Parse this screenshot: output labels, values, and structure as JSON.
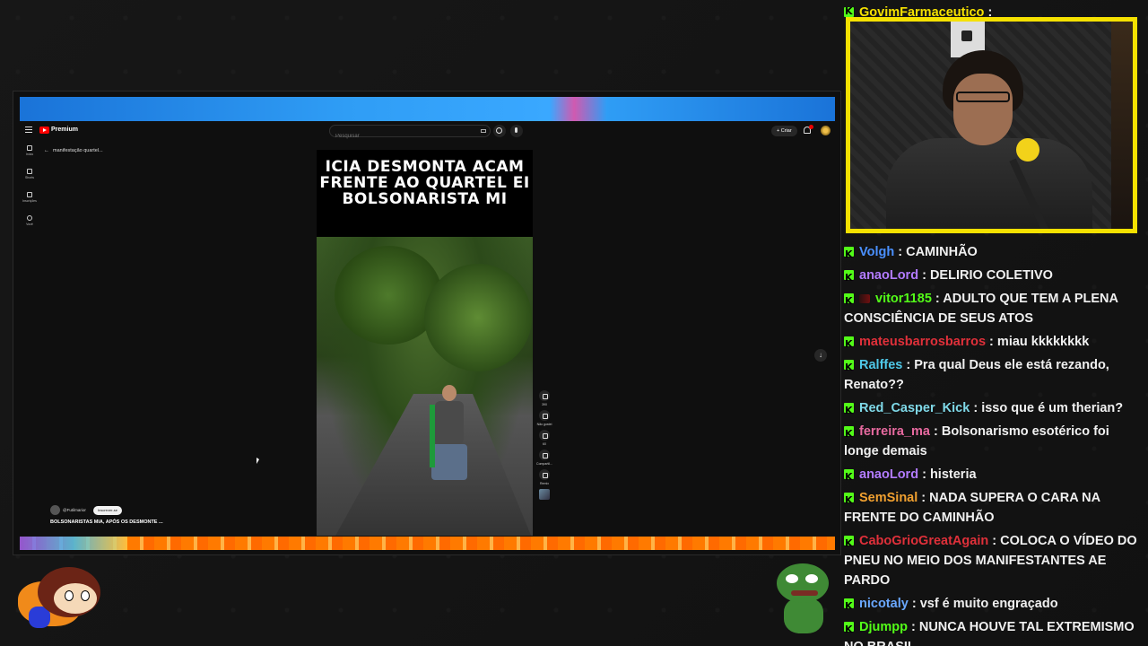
{
  "youtube": {
    "brand": "Premium",
    "search_placeholder": "Pesquisar",
    "create_label": "+ Criar",
    "breadcrumb": "manifestação quartel...",
    "nav": [
      {
        "label": "Início"
      },
      {
        "label": "Shorts"
      },
      {
        "label": "Inscrições"
      },
      {
        "label": "Você"
      }
    ],
    "short": {
      "headline_lines": [
        "ICIA DESMONTA ACAM",
        "FRENTE AO QUARTEL EI",
        "BOLSONARISTA MI"
      ],
      "channel_name": "@Futilmarior",
      "subscribe_label": "Inscrever-se",
      "title": "BOLSONARISTAS MIA, APÓS OS DESMONTE ...",
      "actions": [
        {
          "name": "like",
          "count": "390"
        },
        {
          "name": "dislike",
          "count": "Não gostei"
        },
        {
          "name": "comments",
          "count": "60"
        },
        {
          "name": "share",
          "count": "Compartil..."
        },
        {
          "name": "remix",
          "count": "Remix"
        }
      ]
    }
  },
  "chat": {
    "top_partial": {
      "user": "GovimFarmaceutico",
      "text": ""
    },
    "messages": [
      {
        "user": "Volgh",
        "color": "#4a90ff",
        "text": "CAMINHÃO",
        "badge": "kick"
      },
      {
        "user": "anaoLord",
        "color": "#b27bff",
        "text": "DELIRIO COLETIVO",
        "badge": "kick"
      },
      {
        "user": "vitor1185",
        "color": "#53fc18",
        "text": "ADULTO QUE TEM A PLENA CONSCIÊNCIA DE SEUS ATOS",
        "badge": "kick+mini"
      },
      {
        "user": "mateusbarrosbarros",
        "color": "#e0303a",
        "text": "miau kkkkkkkk",
        "badge": "kick"
      },
      {
        "user": "Ralffes",
        "color": "#4fc8e8",
        "text": "Pra qual Deus ele está rezando, Renato??",
        "badge": "kick"
      },
      {
        "user": "Red_Casper_Kick",
        "color": "#7fd9e8",
        "text": "isso que é um therian?",
        "badge": "kick"
      },
      {
        "user": "ferreira_ma",
        "color": "#e86aa0",
        "text": "Bolsonarismo esotérico foi longe demais",
        "badge": "kick"
      },
      {
        "user": "anaoLord",
        "color": "#b27bff",
        "text": "histeria",
        "badge": "kick"
      },
      {
        "user": "SemSinal",
        "color": "#f0a030",
        "text": "NADA SUPERA O CARA NA FRENTE DO CAMINHÃO",
        "badge": "kick"
      },
      {
        "user": "CaboGrioGreatAgain",
        "color": "#e0303a",
        "text": "COLOCA O VÍDEO DO PNEU NO MEIO DOS MANIFESTANTES AE PARDO",
        "badge": "kick"
      },
      {
        "user": "nicotaly",
        "color": "#6aa8ff",
        "text": "vsf é muito engraçado",
        "badge": "kick"
      },
      {
        "user": "Djumpp",
        "color": "#53fc18",
        "text": "NUNCA HOUVE TAL EXTREMISMO NO BRASIL",
        "badge": "kick"
      }
    ]
  },
  "colors": {
    "cam_border": "#f5e100",
    "kick_green": "#53fc18"
  }
}
